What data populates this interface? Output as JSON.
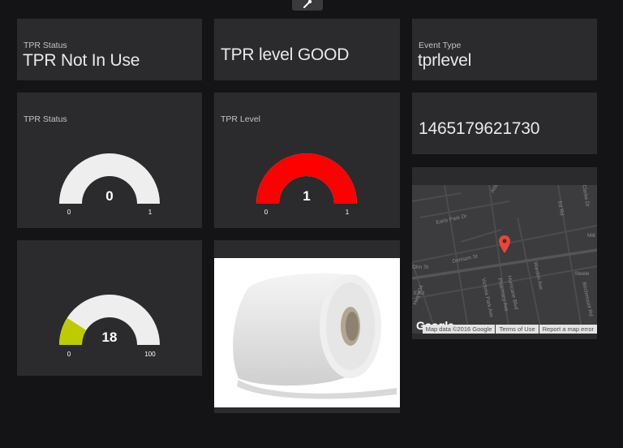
{
  "toolbar": {
    "tool_icon": "wrench-icon"
  },
  "tiles": {
    "tpr_status_text": {
      "label": "TPR Status",
      "value": "TPR Not In Use"
    },
    "tpr_level_text": {
      "value": "TPR level GOOD"
    },
    "event_type": {
      "label": "Event Type",
      "value": "tprlevel"
    },
    "timestamp": {
      "value": "1465179621730"
    }
  },
  "gauges": {
    "tpr_status": {
      "label": "TPR Status",
      "value": 0,
      "value_text": "0",
      "min": 0,
      "max": 1,
      "min_text": "0",
      "max_text": "1",
      "fill_color": "#cccccc",
      "track_color": "#eeeeee"
    },
    "tpr_level": {
      "label": "TPR Level",
      "value": 1,
      "value_text": "1",
      "min": 0,
      "max": 1,
      "min_text": "0",
      "max_text": "1",
      "fill_color": "#ff0000",
      "track_color": "#eeeeee"
    },
    "third": {
      "value": 18,
      "value_text": "18",
      "min": 0,
      "max": 100,
      "min_text": "0",
      "max_text": "100",
      "fill_color": "#bccc00",
      "track_color": "#eeeeee"
    }
  },
  "map": {
    "streets": [
      "Alden",
      "Earls Park Dr",
      "Denison St",
      "Ohn St",
      "Hwy 404",
      "Ed Rd",
      "East",
      "Victoria Park Ave",
      "Pharmacy Ave",
      "Hurricane Blvd",
      "Warden Ave",
      "Birchmount Rd",
      "Steele",
      "Clarke Dr",
      "Mill"
    ],
    "google_logo": "Google",
    "footer": [
      "Map data ©2016 Google",
      "Terms of Use",
      "Report a map error"
    ],
    "pin_color": "#e8453c"
  },
  "image": {
    "subject": "toilet-paper-roll"
  }
}
